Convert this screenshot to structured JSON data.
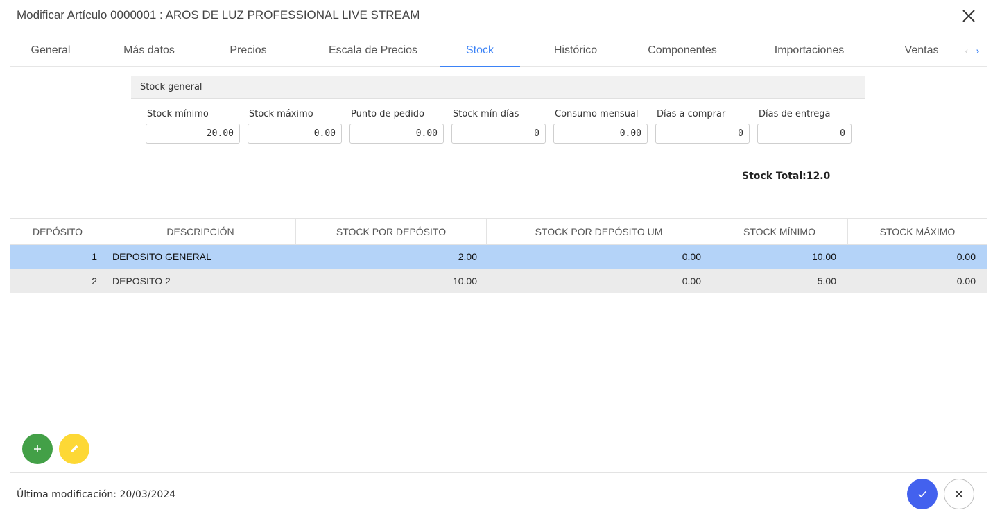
{
  "dialog": {
    "title": "Modificar Artículo 0000001 : AROS DE LUZ PROFESSIONAL LIVE STREAM"
  },
  "tabs": [
    {
      "label": "General"
    },
    {
      "label": "Más datos"
    },
    {
      "label": "Precios"
    },
    {
      "label": "Escala de Precios"
    },
    {
      "label": "Stock",
      "active": true
    },
    {
      "label": "Histórico"
    },
    {
      "label": "Componentes"
    },
    {
      "label": "Importaciones"
    },
    {
      "label": "Ventas"
    }
  ],
  "stock_general": {
    "header": "Stock general",
    "fields": [
      {
        "label": "Stock mínimo",
        "value": "20.00"
      },
      {
        "label": "Stock máximo",
        "value": "0.00"
      },
      {
        "label": "Punto de pedido",
        "value": "0.00"
      },
      {
        "label": "Stock mín días",
        "value": "0"
      },
      {
        "label": "Consumo mensual",
        "value": "0.00"
      },
      {
        "label": "Días a comprar",
        "value": "0"
      },
      {
        "label": "Días de entrega",
        "value": "0"
      }
    ],
    "total_label": "Stock Total:12.0"
  },
  "table": {
    "columns": [
      "DEPÓSITO",
      "DESCRIPCIÓN",
      "STOCK POR DEPÓSITO",
      "STOCK POR DEPÓSITO UM",
      "STOCK MÍNIMO",
      "STOCK MÁXIMO"
    ],
    "rows": [
      {
        "deposito": "1",
        "descripcion": "DEPOSITO GENERAL",
        "stock": "2.00",
        "stock_um": "0.00",
        "minimo": "10.00",
        "maximo": "0.00",
        "selected": true
      },
      {
        "deposito": "2",
        "descripcion": "DEPOSITO 2",
        "stock": "10.00",
        "stock_um": "0.00",
        "minimo": "5.00",
        "maximo": "0.00"
      }
    ]
  },
  "footer": {
    "last_modified": "Última modificación: 20/03/2024"
  },
  "colors": {
    "accent": "#3b82f6",
    "selected_row": "#b4d3f8",
    "add_button": "#43a047",
    "edit_button": "#fdd835",
    "confirm_button": "#4361ee"
  }
}
